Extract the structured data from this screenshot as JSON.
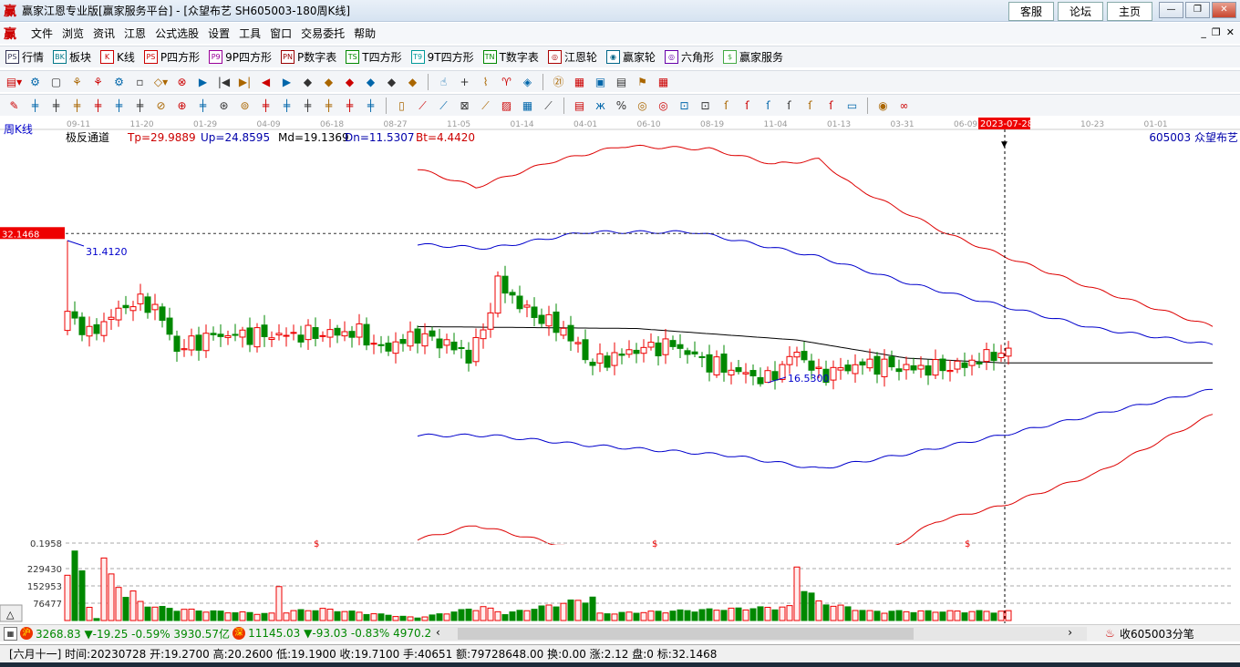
{
  "window": {
    "title": "赢家江恩专业版[赢家服务平台] - [众望布艺  SH605003-180周K线]",
    "links": [
      "客服",
      "论坛",
      "主页"
    ],
    "controls": [
      "—",
      "❐",
      "✕"
    ]
  },
  "menu": [
    "文件",
    "浏览",
    "资讯",
    "江恩",
    "公式选股",
    "设置",
    "工具",
    "窗口",
    "交易委托",
    "帮助"
  ],
  "toolbar": [
    {
      "icon": "PS",
      "label": "行情",
      "c": "#335"
    },
    {
      "icon": "BK",
      "label": "板块",
      "c": "#078"
    },
    {
      "icon": "K",
      "label": "K线",
      "c": "#c00"
    },
    {
      "icon": "PS",
      "label": "P四方形",
      "c": "#c00"
    },
    {
      "icon": "P9",
      "label": "9P四方形",
      "c": "#909"
    },
    {
      "icon": "PN",
      "label": "P数字表",
      "c": "#900"
    },
    {
      "icon": "TS",
      "label": "T四方形",
      "c": "#080"
    },
    {
      "icon": "T9",
      "label": "9T四方形",
      "c": "#099"
    },
    {
      "icon": "TN",
      "label": "T数字表",
      "c": "#080"
    },
    {
      "icon": "◎",
      "label": "江恩轮",
      "c": "#a00"
    },
    {
      "icon": "◉",
      "label": "赢家轮",
      "c": "#068"
    },
    {
      "icon": "◎",
      "label": "六角形",
      "c": "#60a"
    },
    {
      "icon": "$",
      "label": "赢家服务",
      "c": "#4a4"
    }
  ],
  "period_label": "周K线",
  "indicator": {
    "name": "极反通道",
    "tp": "Tp=29.9889",
    "up": "Up=24.8595",
    "md": "Md=19.1369",
    "dn": "Dn=11.5307",
    "bt": "Bt=4.4420"
  },
  "stock_label": "605003  众望布艺",
  "price_marker": "32.1468",
  "cursor_date": "2023-07-28",
  "chart_data": {
    "type": "candlestick",
    "date_ticks": [
      "09-11",
      "11-20",
      "01-29",
      "04-09",
      "06-18",
      "08-27",
      "11-05",
      "01-14",
      "04-01",
      "06-10",
      "08-19",
      "11-04",
      "01-13",
      "03-31",
      "06-09",
      "2023-07-28",
      "10-23",
      "01-01"
    ],
    "annotations": {
      "high": "31.4120",
      "low": "16.5300"
    },
    "close_keypoints": [
      [
        0,
        24
      ],
      [
        3,
        21.5
      ],
      [
        6,
        23.5
      ],
      [
        9,
        25
      ],
      [
        12,
        24.5
      ],
      [
        15,
        20
      ],
      [
        20,
        21.5
      ],
      [
        30,
        21.5
      ],
      [
        40,
        21.8
      ],
      [
        43,
        20
      ],
      [
        48,
        21.5
      ],
      [
        52,
        20.6
      ],
      [
        55,
        19.3
      ],
      [
        57,
        22
      ],
      [
        59,
        27
      ],
      [
        63,
        24
      ],
      [
        68,
        22
      ],
      [
        72,
        18.5
      ],
      [
        78,
        20
      ],
      [
        83,
        20.5
      ],
      [
        88,
        18.5
      ],
      [
        96,
        16.8
      ],
      [
        100,
        19.8
      ],
      [
        103,
        17.3
      ],
      [
        109,
        18.5
      ],
      [
        116,
        18
      ],
      [
        122,
        18.2
      ],
      [
        128,
        19.7
      ],
      [
        129,
        19.5
      ]
    ],
    "ma_line": [
      [
        48,
        22.4
      ],
      [
        78,
        22.2
      ],
      [
        100,
        21
      ],
      [
        115,
        19.1
      ],
      [
        128,
        18.6
      ],
      [
        157,
        18.6
      ]
    ],
    "upper_red": [
      [
        48,
        38.9
      ],
      [
        56,
        37
      ],
      [
        66,
        39.6
      ],
      [
        76,
        41.3
      ],
      [
        88,
        41
      ],
      [
        97,
        39.4
      ],
      [
        103,
        39.9
      ],
      [
        108,
        37
      ],
      [
        121,
        32
      ],
      [
        128,
        29.9
      ],
      [
        141,
        26.3
      ],
      [
        157,
        22.4
      ]
    ],
    "upper_blue": [
      [
        48,
        31
      ],
      [
        58,
        30.6
      ],
      [
        71,
        32.3
      ],
      [
        86,
        32.3
      ],
      [
        103,
        29.7
      ],
      [
        116,
        26.8
      ],
      [
        128,
        24.6
      ],
      [
        141,
        22.2
      ],
      [
        157,
        20.5
      ]
    ],
    "lower_blue": [
      [
        48,
        11
      ],
      [
        58,
        11
      ],
      [
        71,
        10
      ],
      [
        91,
        8.9
      ],
      [
        103,
        7.5
      ],
      [
        116,
        9.2
      ],
      [
        128,
        11
      ],
      [
        141,
        13.2
      ],
      [
        157,
        15.8
      ]
    ],
    "lower_red": [
      [
        48,
        0.1
      ],
      [
        56,
        1.6
      ],
      [
        66,
        -0.2
      ],
      [
        76,
        -2
      ],
      [
        103,
        -5
      ],
      [
        114,
        -0.3
      ],
      [
        119,
        2
      ],
      [
        128,
        3.6
      ],
      [
        141,
        7
      ],
      [
        157,
        13.2
      ]
    ],
    "volume_ticks": [
      "0.1958",
      "229430",
      "152953",
      "76477"
    ],
    "volume_keypoints": [
      [
        0,
        250000
      ],
      [
        1,
        300000
      ],
      [
        2,
        200000
      ],
      [
        3,
        60000
      ],
      [
        4,
        10000
      ],
      [
        5,
        260000
      ],
      [
        6,
        190000
      ],
      [
        7,
        160000
      ],
      [
        8,
        110000
      ],
      [
        9,
        120000
      ],
      [
        10,
        80000
      ],
      [
        12,
        60000
      ],
      [
        15,
        50000
      ],
      [
        20,
        40000
      ],
      [
        28,
        30000
      ],
      [
        29,
        150000
      ],
      [
        30,
        40000
      ],
      [
        35,
        50000
      ],
      [
        48,
        12000
      ],
      [
        57,
        60000
      ],
      [
        60,
        30000
      ],
      [
        72,
        100000
      ],
      [
        73,
        30000
      ],
      [
        99,
        60000
      ],
      [
        100,
        240000
      ],
      [
        101,
        150000
      ],
      [
        103,
        80000
      ],
      [
        110,
        40000
      ],
      [
        129,
        40000
      ]
    ],
    "dividend_marks": [
      "$",
      "$",
      "$"
    ]
  },
  "index_bar": {
    "sh_badge": "沪",
    "sh": "3268.83 ▼-19.25 -0.59% 3930.57亿",
    "sz_badge": "深",
    "sz": "11145.03 ▼-93.03 -0.83% 4970.20",
    "right": "收605003分笔"
  },
  "status": "[六月十一] 时间:20230728 开:19.2700 高:20.2600 低:19.1900 收:19.7100 手:40651 额:79728648.00 换:0.00 涨:2.12 盘:0 标:32.1468"
}
